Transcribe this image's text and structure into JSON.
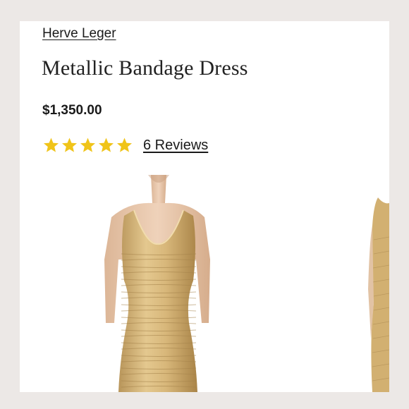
{
  "product": {
    "brand": "Herve Leger",
    "title": "Metallic Bandage Dress",
    "price": "$1,350.00",
    "rating": {
      "stars": 5,
      "max": 5,
      "reviews_label": "6 Reviews"
    }
  },
  "colors": {
    "star": "#f0c419",
    "background": "#ece8e6",
    "card": "#ffffff",
    "dress_gold": "#d7b77d",
    "skin": "#e9c9ad"
  },
  "icons": [
    "star-icon"
  ],
  "images": [
    "product-photo-main",
    "product-photo-alternate"
  ]
}
